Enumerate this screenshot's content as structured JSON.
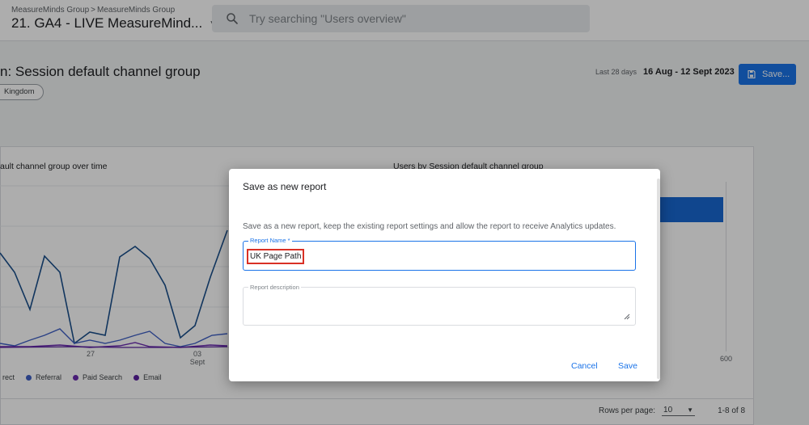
{
  "topbar": {
    "breadcrumb": [
      "MeasureMinds Group",
      "MeasureMinds Group"
    ],
    "property_name": "21. GA4 - LIVE MeasureMind...",
    "search_placeholder": "Try searching \"Users overview\""
  },
  "header": {
    "title": "n: Session default channel group",
    "filter_chip": "Kingdom",
    "date_badge": "Last 28 days",
    "date_range": "16 Aug - 12 Sept 2023",
    "save_label": "Save..."
  },
  "card": {
    "left_title": "ault channel group over time",
    "right_title": "Users by Session default channel group",
    "x_ticks": [
      {
        "day": "27",
        "month": ""
      },
      {
        "day": "03",
        "month": "Sept"
      }
    ],
    "right_axis_tick": "600",
    "legend": [
      {
        "label": "rect",
        "color": "#1a4f8b"
      },
      {
        "label": "Referral",
        "color": "#3e5fc4"
      },
      {
        "label": "Paid Search",
        "color": "#6a2cb0"
      },
      {
        "label": "Email",
        "color": "#5a1fa0"
      }
    ],
    "rows_per_page_label": "Rows per page:",
    "rows_per_page_value": "10",
    "row_count": "1-8 of 8"
  },
  "dialog": {
    "title": "Save as new report",
    "description": "Save as a new report, keep the existing report settings and allow the report to receive Analytics updates.",
    "name_label": "Report Name *",
    "name_value": "UK Page Path",
    "desc_label": "Report description",
    "cancel_label": "Cancel",
    "save_label": "Save"
  },
  "colors": {
    "accent": "#1a73e8",
    "highlight": "#d93025"
  }
}
